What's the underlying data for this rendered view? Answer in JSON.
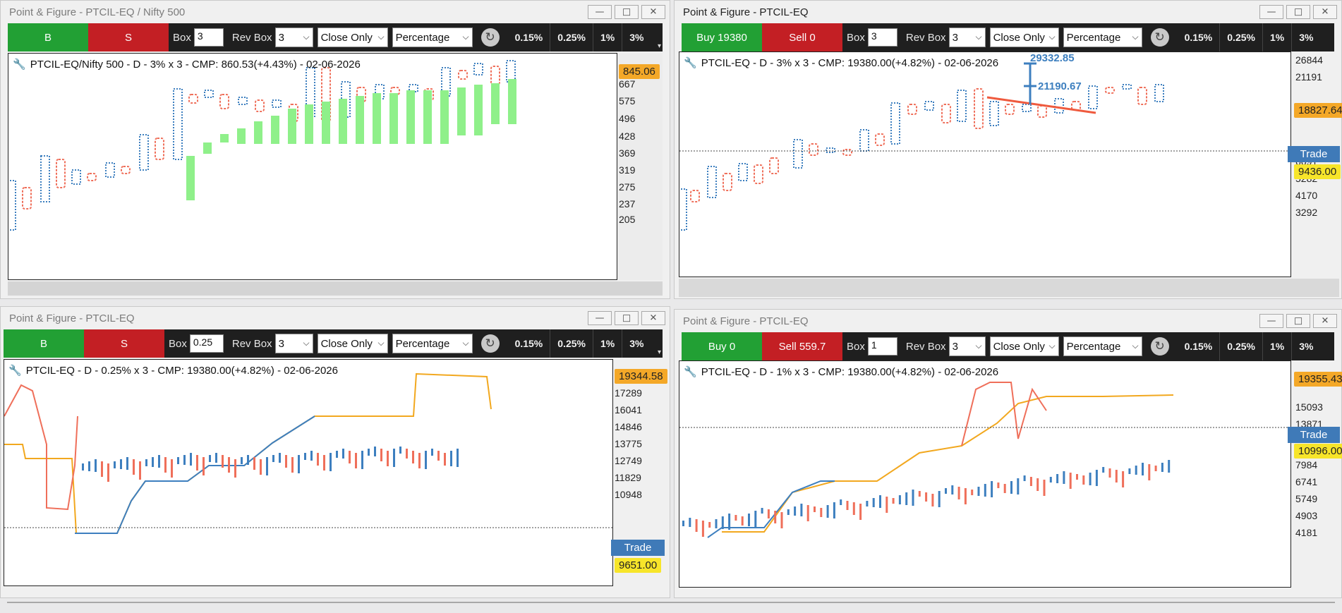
{
  "windows": [
    {
      "title": "Point & Figure - PTCIL-EQ / Nifty 500",
      "buy_label": "B",
      "sell_label": "S",
      "box_label": "Box",
      "box_value": "3",
      "rev_label": "Rev Box",
      "rev_value": "3",
      "price_mode": "Close Only",
      "method": "Percentage",
      "presets": [
        "0.15%",
        "0.25%",
        "1%",
        "3%"
      ],
      "chart_title": "PTCIL-EQ/Nifty 500 - D - 3% x 3 - CMP: 860.53(+4.43%) - 02-06-2026",
      "price_tag": "845.06",
      "y_ticks": [
        "667",
        "575",
        "496",
        "428",
        "369",
        "319",
        "275",
        "237",
        "205"
      ]
    },
    {
      "title": "Point & Figure - PTCIL-EQ",
      "buy_label": "Buy 19380",
      "sell_label": "Sell 0",
      "box_label": "Box",
      "box_value": "3",
      "rev_label": "Rev Box",
      "rev_value": "3",
      "price_mode": "Close Only",
      "method": "Percentage",
      "presets": [
        "0.15%",
        "0.25%",
        "1%",
        "3%"
      ],
      "chart_title": "PTCIL-EQ - D - 3% x 3 - CMP: 19380.00(+4.82%) - 02-06-2026",
      "price_tag": "18827.64",
      "trade_label": "Trade",
      "trade_price": "9436.00",
      "annotation_top": "29332.85",
      "annotation_mid": "21190.67",
      "y_ticks": [
        "26844",
        "21191",
        "13205",
        "6691",
        "5282",
        "4170",
        "3292"
      ]
    },
    {
      "title": "Point & Figure - PTCIL-EQ",
      "buy_label": "B",
      "sell_label": "S",
      "box_label": "Box",
      "box_value": "0.25",
      "rev_label": "Rev Box",
      "rev_value": "3",
      "price_mode": "Close Only",
      "method": "Percentage",
      "presets": [
        "0.15%",
        "0.25%",
        "1%",
        "3%"
      ],
      "chart_title": "PTCIL-EQ - D - 0.25% x 3 - CMP: 19380.00(+4.82%) - 02-06-2026",
      "price_tag": "19344.58",
      "trade_label": "Trade",
      "trade_price": "9651.00",
      "y_ticks": [
        "17289",
        "16041",
        "14846",
        "13775",
        "12749",
        "11829",
        "10948"
      ]
    },
    {
      "title": "Point & Figure - PTCIL-EQ",
      "buy_label": "Buy 0",
      "sell_label": "Sell 559.7",
      "box_label": "Box",
      "box_value": "1",
      "rev_label": "Rev Box",
      "rev_value": "3",
      "price_mode": "Close Only",
      "method": "Percentage",
      "presets": [
        "0.15%",
        "0.25%",
        "1%",
        "3%"
      ],
      "chart_title": "PTCIL-EQ - D - 1% x 3 - CMP: 19380.00(+4.82%) - 02-06-2026",
      "price_tag": "19355.43",
      "trade_label": "Trade",
      "trade_price": "10996.00",
      "y_ticks": [
        "15093",
        "13871",
        "9361",
        "7984",
        "6741",
        "5749",
        "4903",
        "4181"
      ]
    }
  ],
  "window_controls": {
    "minimize": "—",
    "maximize": "□",
    "close": "✕"
  },
  "colors": {
    "x_column": "#3d7fbf",
    "o_column": "#ef6f5a",
    "rs_bar": "#8ff08a",
    "stop_line": "#f2a81f",
    "buy": "#22a034",
    "sell": "#c31f24"
  }
}
